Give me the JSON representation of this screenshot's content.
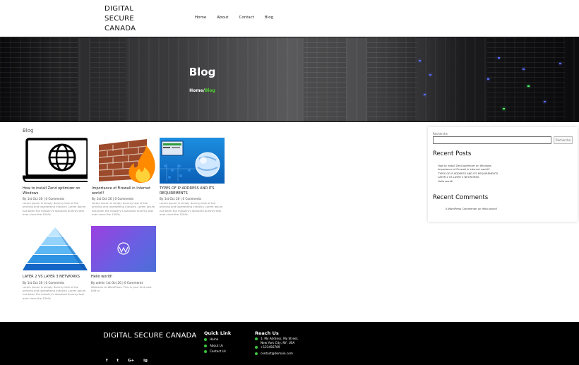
{
  "header": {
    "logo_lines": [
      "DIGITAL",
      "SECURE",
      "CANADA"
    ],
    "nav": [
      "Home",
      "About",
      "Contact",
      "Blog"
    ]
  },
  "hero": {
    "title": "Blog",
    "breadcrumb_home": "Home/",
    "breadcrumb_current": "Blog"
  },
  "main": {
    "section_label": "Blog",
    "posts": [
      {
        "title": "How to install Zend optimizer on Windows",
        "meta_prefix": "By ",
        "date": "1st Oct 20",
        "comments": "0 Comments",
        "excerpt": "Lorem ipsum is simply dummy text of the printing and typesetting industry. Lorem Ipsum has been the industry's standard dummy text ever since the 1500s"
      },
      {
        "title": "Importance of Firewall in Internet world!!",
        "meta_prefix": "By ",
        "date": "1st Oct 20",
        "comments": "0 Comments",
        "excerpt": "Lorem ipsum is simply dummy text of the printing and typesetting industry. Lorem Ipsum has been the industry's standard dummy text ever since the 1500s"
      },
      {
        "title": "TYPES OF IP ADDRESS AND ITS REQUIREMENTS",
        "meta_prefix": "By ",
        "date": "1st Oct 20",
        "comments": "0 Comments",
        "excerpt": "Lorem ipsum is simply dummy text of the printing and typesetting industry. Lorem Ipsum has been the industry's standard dummy text ever since the 1500s"
      },
      {
        "title": "LAYER 2 VS LAYER 3 NETWORKS",
        "meta_prefix": "By ",
        "date": "1st Oct 20",
        "comments": "0 Comments",
        "excerpt": "Lorem ipsum is simply dummy text of the printing and typesetting industry. Lorem Ipsum has been the industry's standard dummy text ever since the 1500s"
      },
      {
        "title": "Hello world!",
        "meta_prefix": "By admin ",
        "date": "1st Oct 20",
        "comments": "0 Comments",
        "excerpt": "Welcome to WordPress. This is your first post. Edit or"
      }
    ]
  },
  "sidebar": {
    "search_label": "Recherche",
    "search_button": "Recherche",
    "recent_posts_title": "Recent Posts",
    "recent_posts": [
      "How to install Zend optimizer on Windows",
      "Importance of Firewall in Internet world!!",
      "TYPES OF IP ADDRESS AND ITS REQUIREMENTS",
      "LAYER 2 VS LAYER 3 NETWORKS",
      "Hello world!"
    ],
    "recent_comments_title": "Recent Comments",
    "recent_comment": "A WordPress Commenter on Hello world!"
  },
  "footer": {
    "brand": "DIGITAL SECURE CANADA",
    "quick_link_title": "Quick Link",
    "quick_links": [
      "Home",
      "About Us",
      "Contact Us"
    ],
    "reach_title": "Reach Us",
    "address": "1, My Address, My Street, New York City, NY, USA",
    "phone": "+123456789",
    "email": "contact@domain.com",
    "social_icons": [
      "f",
      "t",
      "G+",
      "ig"
    ]
  },
  "colors": {
    "accent_green": "#4cd32c",
    "footer_bg": "#000000"
  }
}
